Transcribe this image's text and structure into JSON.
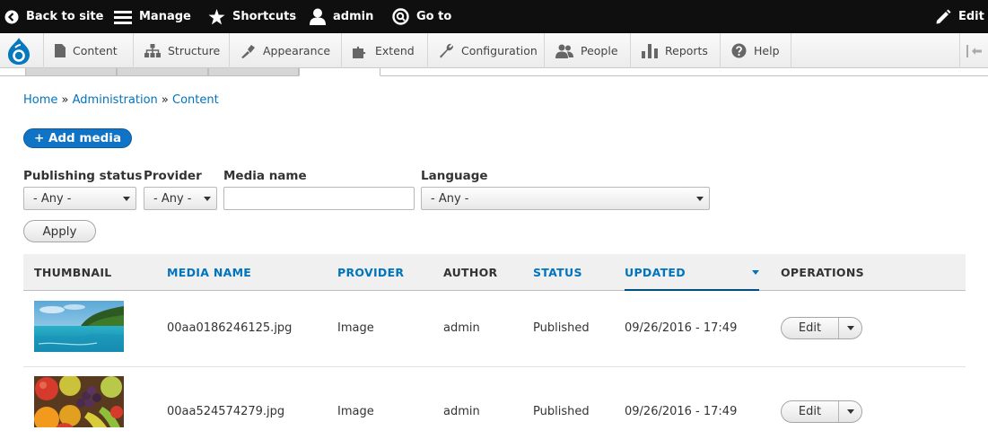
{
  "topbar": {
    "back_to_site": "Back to site",
    "manage": "Manage",
    "shortcuts": "Shortcuts",
    "user": "admin",
    "goto": "Go to",
    "edit": "Edit"
  },
  "tray": {
    "items": [
      "Content",
      "Structure",
      "Appearance",
      "Extend",
      "Configuration",
      "People",
      "Reports",
      "Help"
    ]
  },
  "breadcrumb": {
    "home": "Home",
    "administration": "Administration",
    "content": "Content",
    "separator": "»"
  },
  "actions": {
    "add_media": "+ Add media"
  },
  "filters": {
    "publishing_status": {
      "label": "Publishing status",
      "value": "- Any -"
    },
    "provider": {
      "label": "Provider",
      "value": "- Any -"
    },
    "media_name": {
      "label": "Media name",
      "value": ""
    },
    "language": {
      "label": "Language",
      "value": "- Any -"
    },
    "apply": "Apply"
  },
  "table": {
    "headers": {
      "thumbnail": "THUMBNAIL",
      "media_name": "MEDIA NAME",
      "provider": "PROVIDER",
      "author": "AUTHOR",
      "status": "STATUS",
      "updated": "UPDATED",
      "operations": "OPERATIONS"
    },
    "rows": [
      {
        "name": "00aa0186246125.jpg",
        "provider": "Image",
        "author": "admin",
        "status": "Published",
        "updated": "09/26/2016 - 17:49",
        "operation": "Edit"
      },
      {
        "name": "00aa524574279.jpg",
        "provider": "Image",
        "author": "admin",
        "status": "Published",
        "updated": "09/26/2016 - 17:49",
        "operation": "Edit"
      }
    ]
  },
  "colors": {
    "link": "#0074bd",
    "primary_button": "#0f74c6",
    "topbar": "#0f0f0f"
  }
}
